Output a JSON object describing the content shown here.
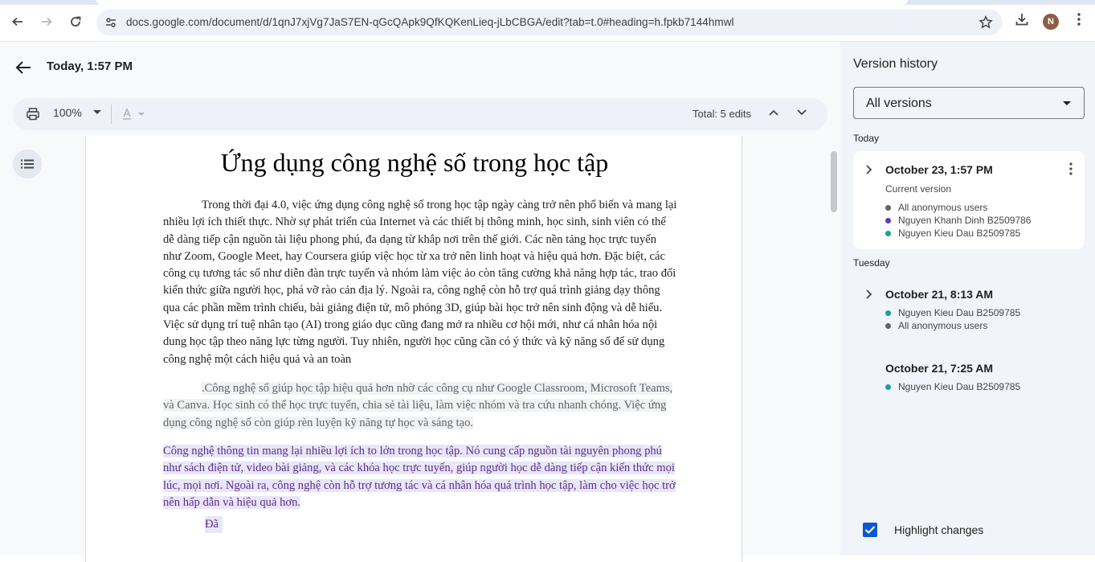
{
  "browser": {
    "url": "docs.google.com/document/d/1qnJ7xjVg7JaS7EN-qGcQApk9QfKQKenLieq-jLbCBGA/edit?tab=t.0#heading=h.fpkb7144hmwl",
    "avatar_letter": "N"
  },
  "header": {
    "title": "Today, 1:57 PM"
  },
  "toolbar": {
    "zoom": "100%",
    "total_edits": "Total: 5 edits"
  },
  "document": {
    "heading": "Ứng dụng công nghệ số trong học tập",
    "paragraph1": "Trong thời đại 4.0, việc ứng dụng công nghệ số trong học tập ngày càng trở nên phổ biến và mang lại nhiều lợi ích thiết thực. Nhờ sự phát triển của Internet và các thiết bị thông minh, học sinh, sinh viên có thể dễ dàng tiếp cận nguồn tài liệu phong phú, đa dạng từ khắp nơi trên thế giới. Các nền tảng học trực tuyến như Zoom, Google Meet, hay Coursera giúp việc học từ xa trở nên linh hoạt và hiệu quả hơn. Đặc biệt, các công cụ tương tác số như diễn đàn trực tuyến và nhóm làm việc ảo còn tăng cường khả năng hợp tác, trao đổi kiến thức giữa người học, phá vỡ rào cản địa lý. Ngoài ra, công nghệ còn hỗ trợ quá trình giảng dạy thông qua các phần mềm trình chiếu, bài giảng điện tử, mô phỏng 3D, giúp bài học trở nên sinh động và dễ hiểu. Việc sử dụng trí tuệ nhân tạo (AI) trong giáo dục cũng đang mở ra nhiều cơ hội mới, như cá nhân hóa nội dung học tập theo năng lực từng người. Tuy nhiên, người học cũng cần có ý thức và kỹ năng số để sử dụng công nghệ một cách hiệu quả và an toàn",
    "paragraph2": ".Công nghệ số giúp học tập hiệu quả hơn nhờ các công cụ như Google Classroom, Microsoft Teams, và Canva. Học sinh có thể học trực tuyến, chia sẻ tài liệu, làm việc nhóm và tra cứu nhanh chóng. Việc ứng dụng công nghệ số còn giúp rèn luyện kỹ năng tự học và sáng tạo.",
    "paragraph3": "Công nghệ thông tin mang lại nhiều lợi ích to lớn trong học tập. Nó cung cấp nguồn tài nguyên phong phú như sách điện tử, video bài giảng, và các khóa học trực tuyến, giúp người học dễ dàng tiếp cận kiến thức mọi lúc, mọi nơi. Ngoài ra, công nghệ còn hỗ trợ tương tác và cá nhân hóa quá trình học tập, làm cho việc học trở nên hấp dẫn và hiệu quả hơn.",
    "paragraph4": "Đã"
  },
  "version_history": {
    "title": "Version history",
    "filter": "All versions",
    "groups": [
      {
        "label": "Today",
        "versions": [
          {
            "date": "October 23, 1:57 PM",
            "subtitle": "Current version",
            "users": [
              {
                "name": "All anonymous users",
                "color": "#5f6368"
              },
              {
                "name": "Nguyen Khanh Dinh B2509786",
                "color": "#673ab7"
              },
              {
                "name": "Nguyen Kieu Dau B2509785",
                "color": "#12a4a0"
              }
            ]
          }
        ]
      },
      {
        "label": "Tuesday",
        "versions": [
          {
            "date": "October 21, 8:13 AM",
            "users": [
              {
                "name": "Nguyen Kieu Dau B2509785",
                "color": "#12a4a0"
              },
              {
                "name": "All anonymous users",
                "color": "#5f6368"
              }
            ]
          },
          {
            "date": "October 21, 7:25 AM",
            "users": [
              {
                "name": "Nguyen Kieu Dau B2509785",
                "color": "#12a4a0"
              }
            ]
          }
        ]
      }
    ],
    "highlight_changes_label": "Highlight changes",
    "highlight_changes_checked": true
  }
}
